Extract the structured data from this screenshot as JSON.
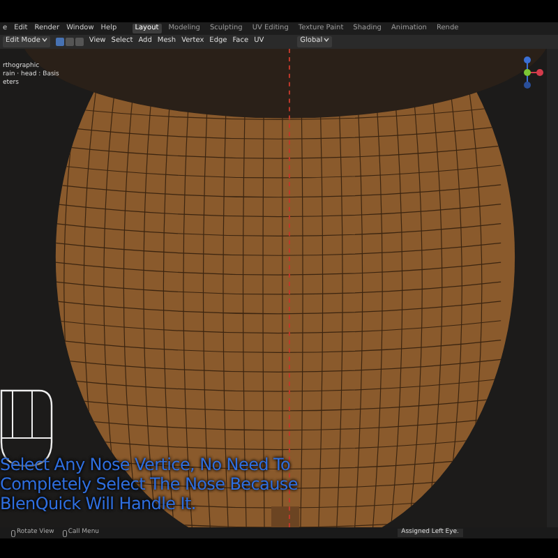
{
  "menu": [
    "e",
    "Edit",
    "Render",
    "Window",
    "Help"
  ],
  "workspace_tabs": [
    {
      "label": "Layout",
      "selected": true
    },
    {
      "label": "Modeling",
      "selected": false
    },
    {
      "label": "Sculpting",
      "selected": false
    },
    {
      "label": "UV Editing",
      "selected": false
    },
    {
      "label": "Texture Paint",
      "selected": false
    },
    {
      "label": "Shading",
      "selected": false
    },
    {
      "label": "Animation",
      "selected": false
    },
    {
      "label": "Rende",
      "selected": false
    }
  ],
  "header": {
    "mode": "Edit Mode",
    "select_modes": [
      {
        "selected": true
      },
      {
        "selected": false
      },
      {
        "selected": false
      }
    ],
    "menus": [
      "View",
      "Select",
      "Add",
      "Mesh",
      "Vertex",
      "Edge",
      "Face",
      "UV"
    ],
    "orientation": "Global"
  },
  "viewport": {
    "info": [
      "rthographic",
      "rain · head : Basis",
      "eters"
    ],
    "caption": [
      "Select Any Nose Vertice, No Need To",
      "Completely Select The Nose Because",
      "BlenQuick Will Handle It."
    ]
  },
  "status_bar": {
    "hints": [
      "Rotate View",
      "Call Menu"
    ],
    "report": "Assigned Left Eye."
  }
}
